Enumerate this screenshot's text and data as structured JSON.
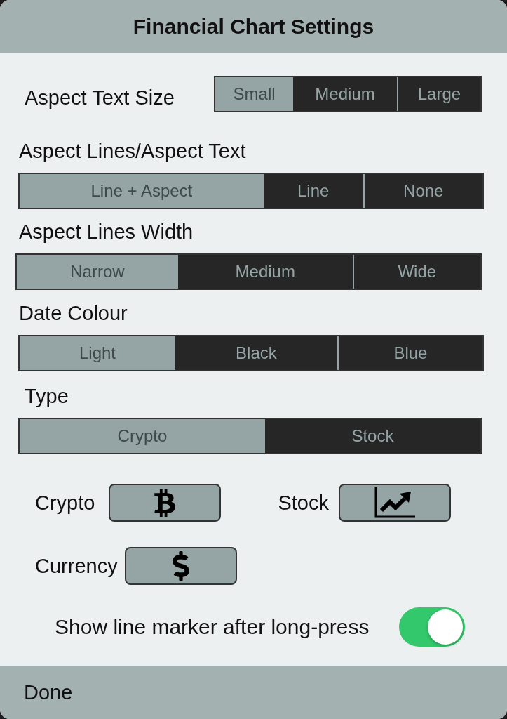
{
  "header": {
    "title": "Financial Chart Settings"
  },
  "settings": [
    {
      "label": "Aspect Text Size",
      "kind": "inline",
      "options": [
        {
          "label": "Small",
          "selected": true
        },
        {
          "label": "Medium",
          "selected": false
        },
        {
          "label": "Large",
          "selected": false
        }
      ]
    },
    {
      "label": "Aspect Lines/Aspect Text",
      "kind": "stacked",
      "options": [
        {
          "label": "Line + Aspect",
          "selected": true
        },
        {
          "label": "Line",
          "selected": false
        },
        {
          "label": "None",
          "selected": false
        }
      ]
    },
    {
      "label": "Aspect Lines Width",
      "kind": "stacked",
      "options": [
        {
          "label": "Narrow",
          "selected": true
        },
        {
          "label": "Medium",
          "selected": false
        },
        {
          "label": "Wide",
          "selected": false
        }
      ]
    },
    {
      "label": "Date Colour",
      "kind": "stacked",
      "options": [
        {
          "label": "Light",
          "selected": true
        },
        {
          "label": "Black",
          "selected": false
        },
        {
          "label": "Blue",
          "selected": false
        }
      ]
    },
    {
      "label": "Type",
      "kind": "stacked",
      "options": [
        {
          "label": "Crypto",
          "selected": true
        },
        {
          "label": "Stock",
          "selected": false
        }
      ]
    }
  ],
  "symbol_rows": [
    {
      "items": [
        {
          "label": "Crypto",
          "kind": "bitcoin"
        },
        {
          "label": "Stock",
          "kind": "chart"
        }
      ]
    },
    {
      "items": [
        {
          "label": "Currency",
          "kind": "dollar"
        }
      ]
    }
  ],
  "toggle": {
    "label": "Show line marker after long-press",
    "on": true
  },
  "footer": {
    "button": "Done"
  }
}
